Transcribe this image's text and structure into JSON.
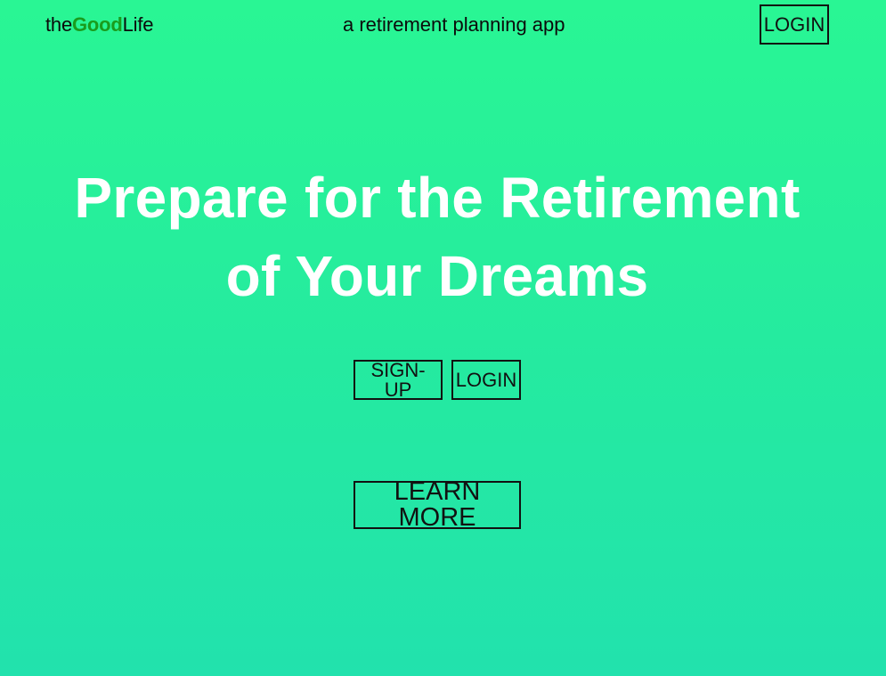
{
  "header": {
    "logo_prefix": "the",
    "logo_highlight": "Good",
    "logo_suffix": "Life",
    "tagline": "a retirement planning app",
    "login_label": "LOGIN"
  },
  "hero": {
    "title_line1": "Prepare for the Retirement",
    "title_line2": "of Your Dreams",
    "signup_label": "SIGN-UP",
    "login_label": "LOGIN",
    "learn_more_label": "LEARN MORE"
  },
  "colors": {
    "background_top": "#29f694",
    "background_bottom": "#22e2ad",
    "logo_highlight": "#1a9c1d",
    "title_text": "#ffffff",
    "button_border": "#111111"
  }
}
